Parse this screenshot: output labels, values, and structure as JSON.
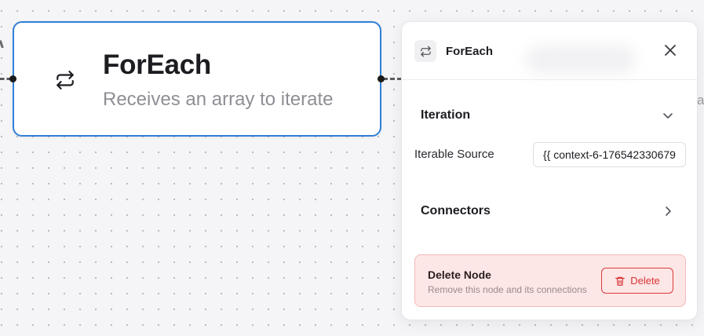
{
  "canvas": {
    "node": {
      "icon": "repeat-icon",
      "title": "ForEach",
      "subtitle": "Receives an array to iterate"
    },
    "edge_color": "#5a5a60",
    "right_glyph": "a"
  },
  "panel": {
    "header": {
      "icon": "repeat-icon",
      "title": "ForEach",
      "close_icon": "close-icon"
    },
    "iteration": {
      "title": "Iteration",
      "expanded": true,
      "iterable_source_label": "Iterable Source",
      "iterable_source_value": "{{ context-6-176542330679"
    },
    "connectors": {
      "title": "Connectors",
      "expanded": false
    },
    "danger_zone": {
      "title": "Delete Node",
      "description": "Remove this node and its connections",
      "delete_label": "Delete",
      "delete_icon": "trash-icon"
    }
  },
  "colors": {
    "accent_border": "#2f7fd6",
    "danger_bg": "#fde6e6",
    "danger_border": "#f5b9b9",
    "danger_text": "#d83434"
  }
}
